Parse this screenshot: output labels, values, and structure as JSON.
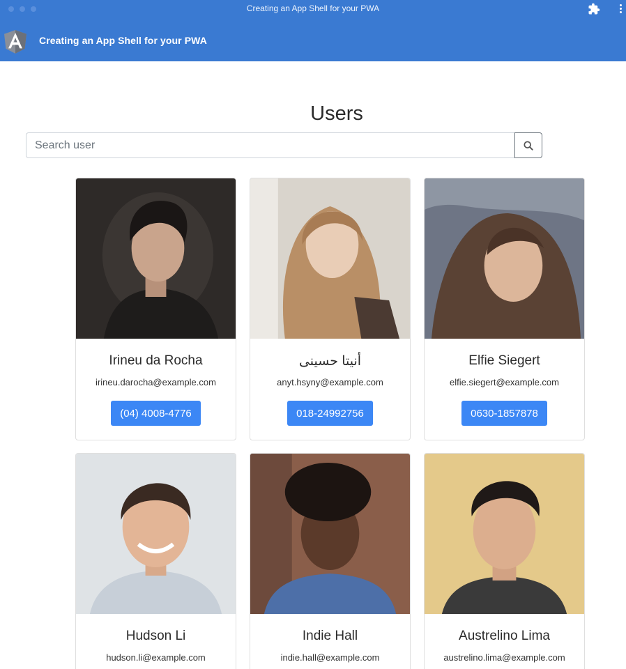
{
  "window": {
    "title": "Creating an App Shell for your PWA",
    "titlebar_color": "#3a7ad2"
  },
  "toolbar": {
    "logo_icon": "angular-logo-icon",
    "logo_letter": "A",
    "title": "Creating an App Shell for your PWA"
  },
  "page": {
    "title": "Users"
  },
  "search": {
    "placeholder": "Search user",
    "value": "",
    "button_icon": "search-icon"
  },
  "users": [
    {
      "name": "Irineu da Rocha",
      "email": "irineu.darocha@example.com",
      "phone": "(04) 4008-4776"
    },
    {
      "name": "أنیتا حسینی",
      "email": "anyt.hsyny@example.com",
      "phone": "018-24992756"
    },
    {
      "name": "Elfie Siegert",
      "email": "elfie.siegert@example.com",
      "phone": "0630-1857878"
    },
    {
      "name": "Hudson Li",
      "email": "hudson.li@example.com",
      "phone": ""
    },
    {
      "name": "Indie Hall",
      "email": "indie.hall@example.com",
      "phone": ""
    },
    {
      "name": "Austrelino Lima",
      "email": "austrelino.lima@example.com",
      "phone": ""
    }
  ],
  "colors": {
    "primary": "#3a7ad2",
    "button": "#3c87f5"
  }
}
